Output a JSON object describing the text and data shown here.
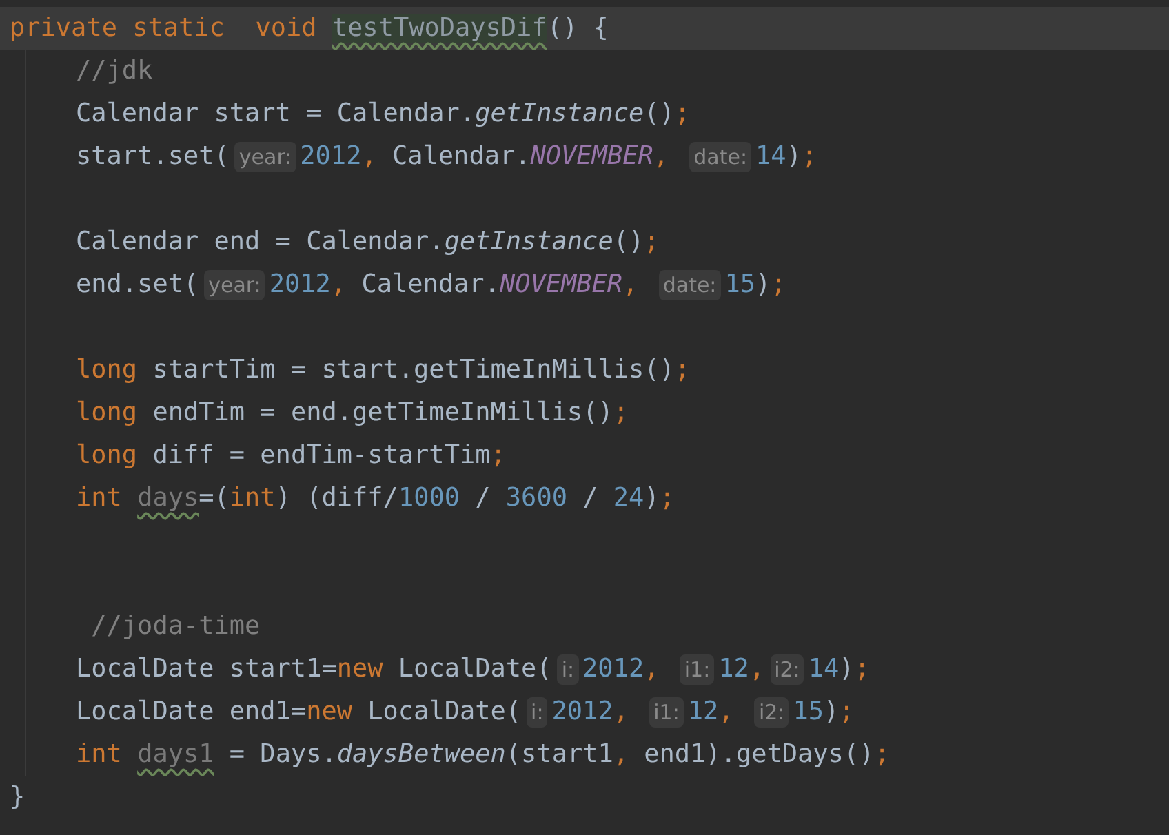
{
  "editor": {
    "lines": [
      {
        "kind": "decl",
        "current": true,
        "segments": [
          {
            "kind": "code",
            "tokens": [
              {
                "kind": "kw",
                "text": "private static  void "
              },
              {
                "kind": "unused-method",
                "text": "testTwoDaysDif"
              },
              {
                "kind": "plain",
                "text": "() {"
              }
            ]
          }
        ]
      },
      {
        "kind": "body",
        "segments": [
          {
            "kind": "code",
            "tokens": [
              {
                "kind": "comment",
                "text": "//jdk"
              }
            ]
          }
        ]
      },
      {
        "kind": "body",
        "segments": [
          {
            "kind": "code",
            "tokens": [
              {
                "kind": "plain",
                "text": "Calendar start = Calendar."
              },
              {
                "kind": "italic",
                "text": "getInstance"
              },
              {
                "kind": "plain",
                "text": "()"
              },
              {
                "kind": "punct",
                "text": ";"
              }
            ]
          }
        ]
      },
      {
        "kind": "body",
        "segments": [
          {
            "kind": "code",
            "tokens": [
              {
                "kind": "plain",
                "text": "start.set("
              }
            ]
          },
          {
            "kind": "hint",
            "text": "year:"
          },
          {
            "kind": "code",
            "tokens": [
              {
                "kind": "num",
                "text": "2012"
              },
              {
                "kind": "punct",
                "text": ", "
              },
              {
                "kind": "plain",
                "text": "Calendar."
              },
              {
                "kind": "const",
                "text": "NOVEMBER"
              },
              {
                "kind": "punct",
                "text": ", "
              }
            ]
          },
          {
            "kind": "hint",
            "text": "date:"
          },
          {
            "kind": "code",
            "tokens": [
              {
                "kind": "num",
                "text": "14"
              },
              {
                "kind": "plain",
                "text": ")"
              },
              {
                "kind": "punct",
                "text": ";"
              }
            ]
          }
        ]
      },
      {
        "kind": "blank"
      },
      {
        "kind": "body",
        "segments": [
          {
            "kind": "code",
            "tokens": [
              {
                "kind": "plain",
                "text": "Calendar end = Calendar."
              },
              {
                "kind": "italic",
                "text": "getInstance"
              },
              {
                "kind": "plain",
                "text": "()"
              },
              {
                "kind": "punct",
                "text": ";"
              }
            ]
          }
        ]
      },
      {
        "kind": "body",
        "segments": [
          {
            "kind": "code",
            "tokens": [
              {
                "kind": "plain",
                "text": "end.set("
              }
            ]
          },
          {
            "kind": "hint",
            "text": "year:"
          },
          {
            "kind": "code",
            "tokens": [
              {
                "kind": "num",
                "text": "2012"
              },
              {
                "kind": "punct",
                "text": ", "
              },
              {
                "kind": "plain",
                "text": "Calendar."
              },
              {
                "kind": "const",
                "text": "NOVEMBER"
              },
              {
                "kind": "punct",
                "text": ", "
              }
            ]
          },
          {
            "kind": "hint",
            "text": "date:"
          },
          {
            "kind": "code",
            "tokens": [
              {
                "kind": "num",
                "text": "15"
              },
              {
                "kind": "plain",
                "text": ")"
              },
              {
                "kind": "punct",
                "text": ";"
              }
            ]
          }
        ]
      },
      {
        "kind": "blank"
      },
      {
        "kind": "body",
        "segments": [
          {
            "kind": "code",
            "tokens": [
              {
                "kind": "kw",
                "text": "long "
              },
              {
                "kind": "plain",
                "text": "startTim = start.getTimeInMillis()"
              },
              {
                "kind": "punct",
                "text": ";"
              }
            ]
          }
        ]
      },
      {
        "kind": "body",
        "segments": [
          {
            "kind": "code",
            "tokens": [
              {
                "kind": "kw",
                "text": "long "
              },
              {
                "kind": "plain",
                "text": "endTim = end.getTimeInMillis()"
              },
              {
                "kind": "punct",
                "text": ";"
              }
            ]
          }
        ]
      },
      {
        "kind": "body",
        "segments": [
          {
            "kind": "code",
            "tokens": [
              {
                "kind": "kw",
                "text": "long "
              },
              {
                "kind": "plain",
                "text": "diff = endTim-startTim"
              },
              {
                "kind": "punct",
                "text": ";"
              }
            ]
          }
        ]
      },
      {
        "kind": "body",
        "segments": [
          {
            "kind": "code",
            "tokens": [
              {
                "kind": "kw",
                "text": "int "
              },
              {
                "kind": "unused",
                "text": "days"
              },
              {
                "kind": "plain",
                "text": "=("
              },
              {
                "kind": "kw",
                "text": "int"
              },
              {
                "kind": "plain",
                "text": ") (diff/"
              },
              {
                "kind": "num",
                "text": "1000"
              },
              {
                "kind": "plain",
                "text": " / "
              },
              {
                "kind": "num",
                "text": "3600"
              },
              {
                "kind": "plain",
                "text": " / "
              },
              {
                "kind": "num",
                "text": "24"
              },
              {
                "kind": "plain",
                "text": ")"
              },
              {
                "kind": "punct",
                "text": ";"
              }
            ]
          }
        ]
      },
      {
        "kind": "blank"
      },
      {
        "kind": "blank"
      },
      {
        "kind": "body",
        "segments": [
          {
            "kind": "code",
            "tokens": [
              {
                "kind": "comment",
                "text": " //joda-time"
              }
            ]
          }
        ]
      },
      {
        "kind": "body",
        "segments": [
          {
            "kind": "code",
            "tokens": [
              {
                "kind": "plain",
                "text": "LocalDate start1="
              },
              {
                "kind": "kw",
                "text": "new "
              },
              {
                "kind": "plain",
                "text": "LocalDate("
              }
            ]
          },
          {
            "kind": "hint",
            "text": "i:"
          },
          {
            "kind": "code",
            "tokens": [
              {
                "kind": "num",
                "text": "2012"
              },
              {
                "kind": "punct",
                "text": ", "
              }
            ]
          },
          {
            "kind": "hint",
            "text": "i1:"
          },
          {
            "kind": "code",
            "tokens": [
              {
                "kind": "num",
                "text": "12"
              },
              {
                "kind": "punct",
                "text": ","
              }
            ]
          },
          {
            "kind": "hint",
            "text": "i2:"
          },
          {
            "kind": "code",
            "tokens": [
              {
                "kind": "num",
                "text": "14"
              },
              {
                "kind": "plain",
                "text": ")"
              },
              {
                "kind": "punct",
                "text": ";"
              }
            ]
          }
        ]
      },
      {
        "kind": "body",
        "segments": [
          {
            "kind": "code",
            "tokens": [
              {
                "kind": "plain",
                "text": "LocalDate end1="
              },
              {
                "kind": "kw",
                "text": "new "
              },
              {
                "kind": "plain",
                "text": "LocalDate("
              }
            ]
          },
          {
            "kind": "hint",
            "text": "i:"
          },
          {
            "kind": "code",
            "tokens": [
              {
                "kind": "num",
                "text": "2012"
              },
              {
                "kind": "punct",
                "text": ", "
              }
            ]
          },
          {
            "kind": "hint",
            "text": "i1:"
          },
          {
            "kind": "code",
            "tokens": [
              {
                "kind": "num",
                "text": "12"
              },
              {
                "kind": "punct",
                "text": ", "
              }
            ]
          },
          {
            "kind": "hint",
            "text": "i2:"
          },
          {
            "kind": "code",
            "tokens": [
              {
                "kind": "num",
                "text": "15"
              },
              {
                "kind": "plain",
                "text": ")"
              },
              {
                "kind": "punct",
                "text": ";"
              }
            ]
          }
        ]
      },
      {
        "kind": "body",
        "segments": [
          {
            "kind": "code",
            "tokens": [
              {
                "kind": "kw",
                "text": "int "
              },
              {
                "kind": "unused",
                "text": "days1"
              },
              {
                "kind": "plain",
                "text": " = Days."
              },
              {
                "kind": "italic",
                "text": "daysBetween"
              },
              {
                "kind": "plain",
                "text": "(start1"
              },
              {
                "kind": "punct",
                "text": ", "
              },
              {
                "kind": "plain",
                "text": "end1).getDays()"
              },
              {
                "kind": "punct",
                "text": ";"
              }
            ]
          }
        ]
      },
      {
        "kind": "close",
        "segments": [
          {
            "kind": "code",
            "tokens": [
              {
                "kind": "plain",
                "text": "}"
              }
            ]
          }
        ]
      }
    ]
  }
}
